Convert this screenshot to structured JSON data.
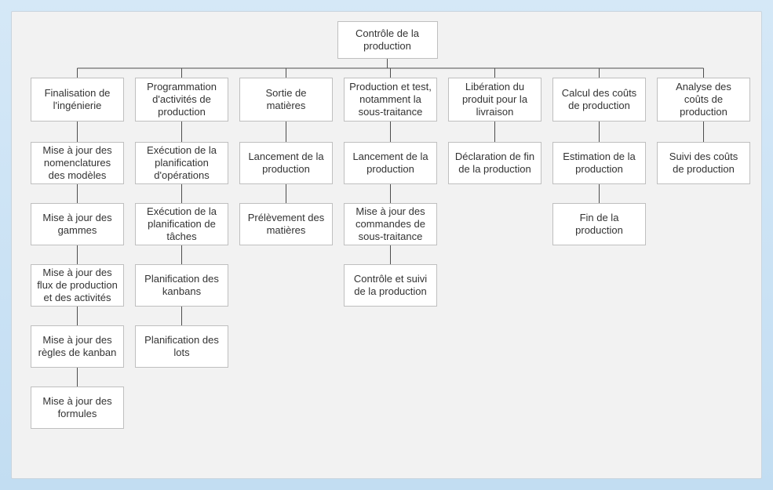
{
  "root": {
    "label": "Contrôle de la production"
  },
  "columns": [
    {
      "head": "Finalisation de l'ingénierie",
      "children": [
        "Mise à jour des nomenclatures des modèles",
        "Mise à jour des gammes",
        "Mise à jour des flux de production et des activités",
        "Mise à jour des règles de kanban",
        "Mise à jour des formules"
      ]
    },
    {
      "head": "Programmation d'activités de production",
      "children": [
        "Exécution de la planification d'opérations",
        "Exécution de la planification de tâches",
        "Planification des kanbans",
        "Planification des lots"
      ]
    },
    {
      "head": "Sortie de matières",
      "children": [
        "Lancement de la production",
        "Prélèvement des matières"
      ]
    },
    {
      "head": "Production et test, notamment la sous-traitance",
      "children": [
        "Lancement de la production",
        "Mise à jour des commandes de sous-traitance",
        "Contrôle et suivi de la production"
      ]
    },
    {
      "head": "Libération du produit pour la livraison",
      "children": [
        "Déclaration de fin de la production"
      ]
    },
    {
      "head": "Calcul des coûts de production",
      "children": [
        "Estimation de la production",
        "Fin de la production"
      ]
    },
    {
      "head": "Analyse des coûts de production",
      "children": [
        "Suivi des coûts de production"
      ]
    }
  ]
}
